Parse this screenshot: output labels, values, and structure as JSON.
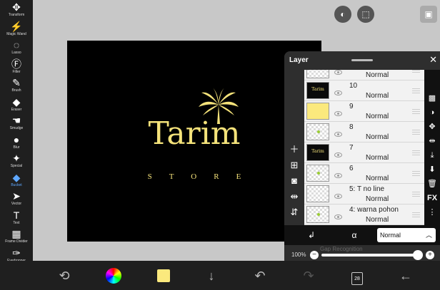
{
  "toolbar": {
    "tools": [
      {
        "name": "transform",
        "label": "Transform",
        "icon": "move-icon",
        "glyph": "✥"
      },
      {
        "name": "magic-wand",
        "label": "Magic Wand",
        "icon": "magic-wand-icon",
        "glyph": "⚡"
      },
      {
        "name": "lasso",
        "label": "Lasso",
        "icon": "lasso-icon",
        "glyph": "◌"
      },
      {
        "name": "filter",
        "label": "Filter",
        "icon": "fx-icon",
        "glyph": "Ⓕ"
      },
      {
        "name": "brush",
        "label": "Brush",
        "icon": "brush-icon",
        "glyph": "✎"
      },
      {
        "name": "eraser",
        "label": "Eraser",
        "icon": "eraser-icon",
        "glyph": "◆"
      },
      {
        "name": "smudge",
        "label": "Smudge",
        "icon": "smudge-icon",
        "glyph": "☚"
      },
      {
        "name": "blur",
        "label": "Blur",
        "icon": "droplet-icon",
        "glyph": "●"
      },
      {
        "name": "special",
        "label": "Special",
        "icon": "special-icon",
        "glyph": "✦"
      },
      {
        "name": "bucket",
        "label": "Bucket",
        "icon": "bucket-icon",
        "glyph": "◆",
        "active": true
      },
      {
        "name": "vector",
        "label": "Vector",
        "icon": "cursor-icon",
        "glyph": "➤"
      },
      {
        "name": "text",
        "label": "Text",
        "icon": "text-icon",
        "glyph": "T"
      },
      {
        "name": "frame-divider",
        "label": "Frame Divider",
        "icon": "frame-divider-icon",
        "glyph": "▦"
      },
      {
        "name": "eyedropper",
        "label": "Eyedropper",
        "icon": "eyedropper-icon",
        "glyph": "✑"
      },
      {
        "name": "canvas",
        "label": "",
        "icon": "canvas-icon",
        "glyph": "▭"
      }
    ]
  },
  "artwork": {
    "title": "Tarim",
    "subtitle": "STORE",
    "colors": {
      "background": "#000000",
      "text": "#f4e27a"
    }
  },
  "layer_panel": {
    "title": "Layer",
    "close_glyph": "✕",
    "layers": [
      {
        "name": "",
        "blend": "Normal",
        "thumb": "transparent"
      },
      {
        "name": "10",
        "blend": "Normal",
        "thumb": "dark",
        "mark": "Tarim"
      },
      {
        "name": "9",
        "blend": "Normal",
        "thumb": "yellow"
      },
      {
        "name": "8",
        "blend": "Normal",
        "thumb": "transparent",
        "mark_dot": true
      },
      {
        "name": "7",
        "blend": "Normal",
        "thumb": "dark",
        "mark": "Tarim"
      },
      {
        "name": "6",
        "blend": "Normal",
        "thumb": "transparent",
        "mark_dot": true
      },
      {
        "name": "5: T no line",
        "blend": "Normal",
        "thumb": "transparent"
      },
      {
        "name": "4: warna pohon",
        "blend": "Normal",
        "thumb": "transparent",
        "mark_dot": true
      }
    ],
    "blend_mode": "Normal",
    "opacity": "100%",
    "gap_recognition": "Gap Recognition",
    "side_fx": "FX"
  },
  "bottombar": {
    "color_swatch": "#fbe97d",
    "page_count": "28"
  }
}
